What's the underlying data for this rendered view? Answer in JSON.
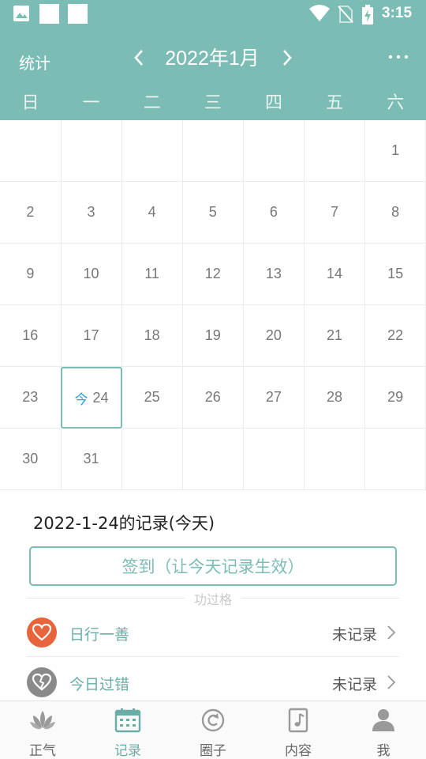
{
  "status_bar": {
    "time": "3:15"
  },
  "header": {
    "stats_label": "统计",
    "month_title": "2022年1月",
    "weekdays": [
      "日",
      "一",
      "二",
      "三",
      "四",
      "五",
      "六"
    ]
  },
  "calendar": {
    "today_tag": "今",
    "rows": [
      [
        "",
        "",
        "",
        "",
        "",
        "",
        "1"
      ],
      [
        "2",
        "3",
        "4",
        "5",
        "6",
        "7",
        "8"
      ],
      [
        "9",
        "10",
        "11",
        "12",
        "13",
        "14",
        "15"
      ],
      [
        "16",
        "17",
        "18",
        "19",
        "20",
        "21",
        "22"
      ],
      [
        "23",
        "24",
        "25",
        "26",
        "27",
        "28",
        "29"
      ],
      [
        "30",
        "31",
        "",
        "",
        "",
        "",
        ""
      ]
    ],
    "today": "24"
  },
  "record": {
    "title": "2022-1-24的记录(今天)",
    "signin_label": "签到（让今天记录生效）",
    "section_label": "功过格",
    "items": [
      {
        "label": "日行一善",
        "status": "未记录"
      },
      {
        "label": "今日过错",
        "status": "未记录"
      }
    ]
  },
  "tabs": [
    {
      "label": "正气"
    },
    {
      "label": "记录"
    },
    {
      "label": "圈子"
    },
    {
      "label": "内容"
    },
    {
      "label": "我"
    }
  ],
  "colors": {
    "primary": "#7bbcb5",
    "today_tag": "#2a9fd6",
    "good_icon": "#e8643c",
    "bad_icon": "#8a8a8a"
  }
}
